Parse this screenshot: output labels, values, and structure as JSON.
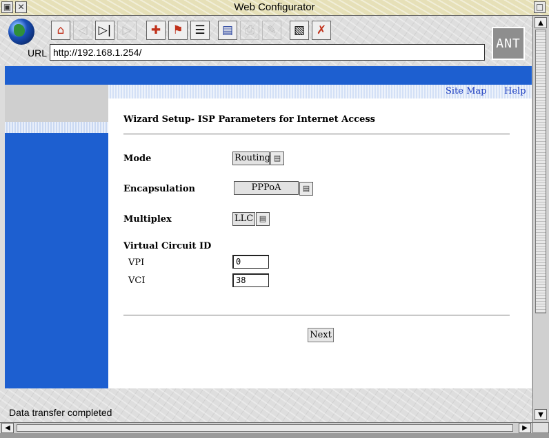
{
  "window": {
    "title": "Web Configurator"
  },
  "toolbar": {
    "icons": [
      "globe-icon",
      "home-icon",
      "back-icon",
      "stop-icon",
      "forward-icon",
      "add-hotlist-icon",
      "hotlist-icon",
      "history-icon",
      "save-icon",
      "print-icon",
      "edit-icon",
      "view-source-icon",
      "cancel-icon"
    ],
    "logo_text": "ANT"
  },
  "address": {
    "label": "URL",
    "value": "http://192.168.1.254/"
  },
  "page": {
    "links": {
      "site_map": "Site Map",
      "help": "Help"
    },
    "title": "Wizard Setup- ISP Parameters for Internet Access",
    "fields": {
      "mode": {
        "label": "Mode",
        "value": "Routing"
      },
      "encapsulation": {
        "label": "Encapsulation",
        "value": "PPPoA"
      },
      "multiplex": {
        "label": "Multiplex",
        "value": "LLC"
      },
      "vc_header": "Virtual Circuit ID",
      "vpi": {
        "label": "VPI",
        "value": "0"
      },
      "vci": {
        "label": "VCI",
        "value": "38"
      }
    },
    "next_button": "Next"
  },
  "status": {
    "text": "Data transfer completed"
  },
  "colors": {
    "accent": "#1d5fd0",
    "link": "#1a3bbf"
  }
}
